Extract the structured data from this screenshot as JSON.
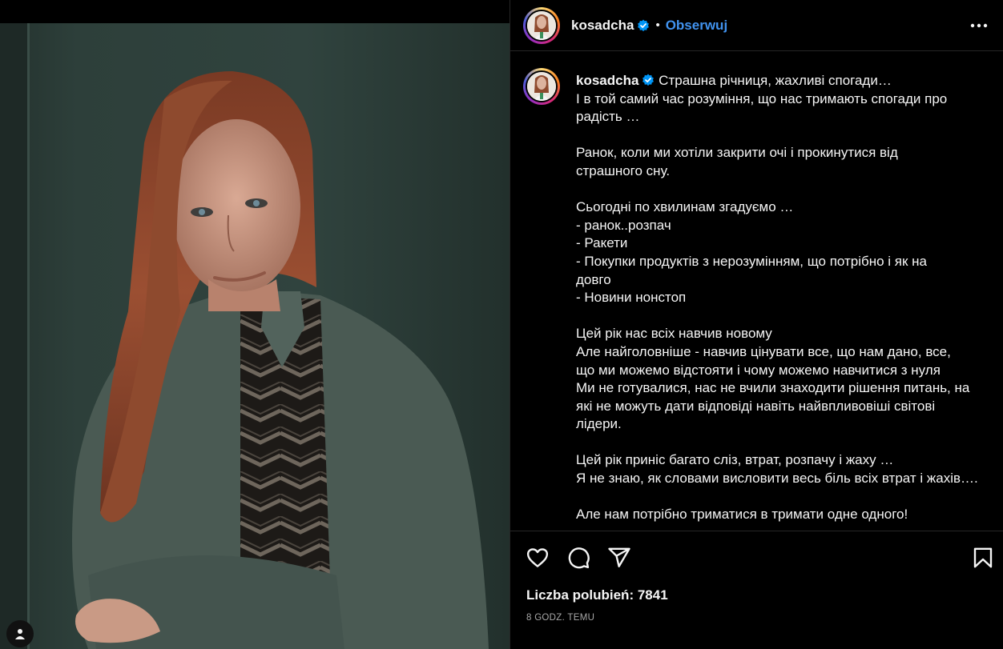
{
  "post": {
    "username": "kosadcha",
    "follow_label": "Obserwuj",
    "header_separator": "•",
    "caption_first_line": "Страшна річниця, жахливі спогади…",
    "caption_lines": [
      "І в той самий час розуміння, що нас тримають спогади про",
      "радість …",
      "",
      "Ранок, коли ми хотіли закрити очі і прокинутися від",
      "страшного сну.",
      "",
      "Сьогодні по хвилинам згадуємо …",
      "- ранок..розпач",
      "- Ракети",
      "- Покупки продуктів з нерозумінням, що потрібно і як на",
      "довго",
      "- Новини нонстоп",
      "",
      "Цей рік нас всіх навчив новому",
      "Але найголовніше - навчив цінувати все, що нам дано, все,",
      "що ми можемо відстояти і чому можемо навчитися з нуля",
      "Ми не готувалися, нас не вчили знаходити рішення питань, на",
      "які не можуть дати відповіді навіть найвпливовіші світові",
      "лідери.",
      "",
      "Цей рік приніс багато сліз, втрат, розпачу і жаху …",
      "Я не знаю, як словами висловити весь біль всіх втрат і жахів….",
      "",
      "Але нам потрібно триматися в тримати одне одного!"
    ],
    "likes_label": "Liczba polubień: 7841",
    "timestamp": "8 GODZ. TEMU"
  },
  "icons": {
    "verified": "verified-badge-icon",
    "more": "more-options-icon",
    "like": "heart-icon",
    "comment": "comment-bubble-icon",
    "share": "paper-plane-icon",
    "save": "bookmark-icon",
    "user_tags": "user-tag-icon"
  },
  "colors": {
    "background": "#000000",
    "link": "#4193ef",
    "verified": "#0095f6",
    "divider": "#262626",
    "muted_text": "#a8a8a8"
  }
}
